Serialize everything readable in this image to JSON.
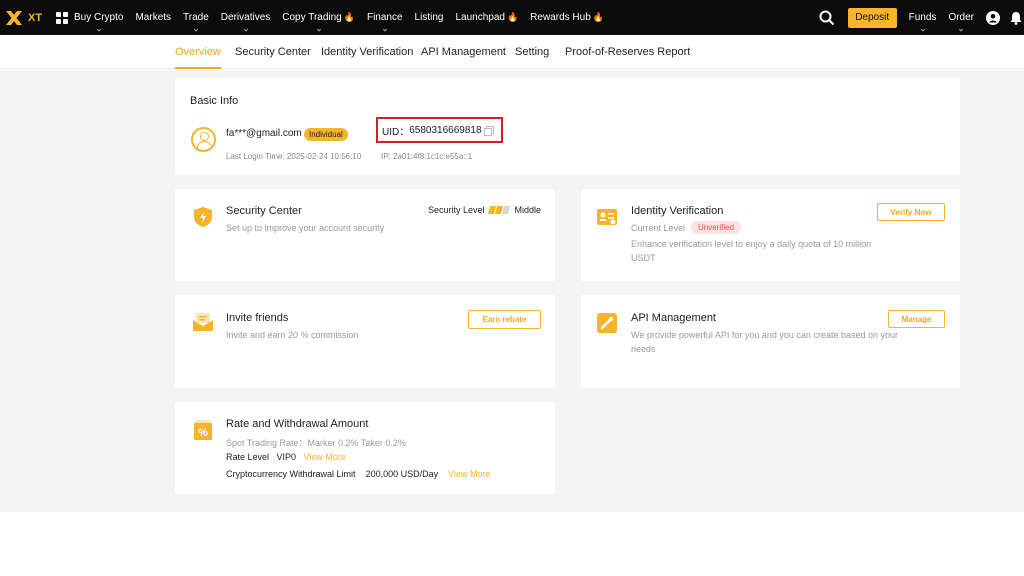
{
  "brand": {
    "name": "XT",
    "accent": "#f5b42a"
  },
  "topnav": {
    "items": [
      {
        "label": "Buy Crypto",
        "hot": false
      },
      {
        "label": "Markets",
        "hot": false
      },
      {
        "label": "Trade",
        "hot": false
      },
      {
        "label": "Derivatives",
        "hot": false
      },
      {
        "label": "Copy Trading",
        "hot": true
      },
      {
        "label": "Finance",
        "hot": false
      },
      {
        "label": "Listing",
        "hot": false
      },
      {
        "label": "Launchpad",
        "hot": true
      },
      {
        "label": "Rewards Hub",
        "hot": true
      }
    ],
    "deposit": "Deposit",
    "funds": "Funds",
    "order": "Order"
  },
  "subnav": {
    "tabs": [
      "Overview",
      "Security Center",
      "Identity Verification",
      "API Management",
      "Setting",
      "Proof-of-Reserves Report"
    ],
    "active": "Overview"
  },
  "basic_info": {
    "title": "Basic Info",
    "email": "fa***@gmail.com",
    "badge": "Individual",
    "uid_label": "UID：",
    "uid": "6580316669818",
    "last_login": "Last Login Time: 2025-02-24 10:56:10",
    "ip": "IP: 2a01:4f8:1c1c:e55a::1"
  },
  "security_center": {
    "title": "Security Center",
    "desc": "Set up to improve your account security",
    "level_label": "Security Level",
    "level_value": "Middle",
    "level_bars": 3,
    "level_filled": 2
  },
  "identity": {
    "title": "Identity Verification",
    "current_label": "Current Level",
    "status": "Unverified",
    "desc_line1": "Enhance verification level to enjoy a daily quota of 10 million",
    "desc_line2": "USDT",
    "button": "Verify Now"
  },
  "invite": {
    "title": "Invite friends",
    "desc": "Invite and earn 20 % commission",
    "button": "Earn rebate"
  },
  "api": {
    "title": "API Management",
    "desc_line1": "We provide powerful API for you and you can create based on your",
    "desc_line2": "needs",
    "button": "Manage"
  },
  "rate": {
    "title": "Rate and Withdrawal Amount",
    "spot_rate": "Spot Trading Rate：Marker 0.2% Taker 0.2%",
    "rate_level_label": "Rate Level",
    "rate_level_value": "VIP0",
    "view_more_1": "View More",
    "withdraw_label": "Cryptocurrency Withdrawal Limit",
    "withdraw_value": "200,000 USD/Day",
    "view_more_2": "View More"
  }
}
